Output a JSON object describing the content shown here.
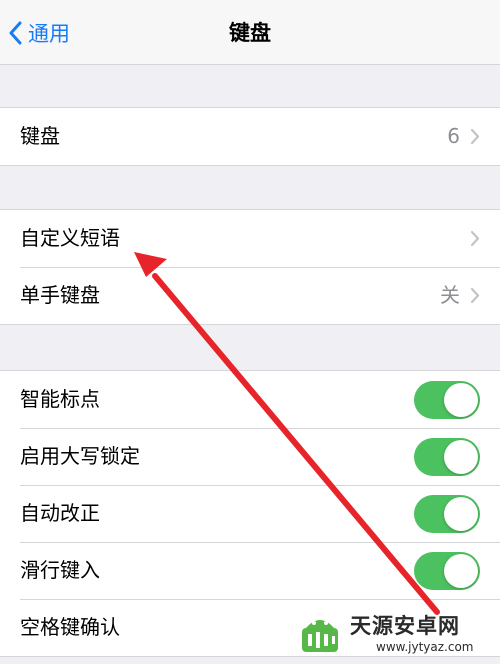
{
  "nav": {
    "back_label": "通用",
    "title": "键盘"
  },
  "section1": {
    "keyboards": {
      "label": "键盘",
      "value": "6"
    }
  },
  "section2": {
    "text_replacement": {
      "label": "自定义短语"
    },
    "one_handed": {
      "label": "单手键盘",
      "value": "关"
    }
  },
  "section3": {
    "items": [
      {
        "label": "智能标点",
        "on": true
      },
      {
        "label": "启用大写锁定",
        "on": true
      },
      {
        "label": "自动改正",
        "on": true
      },
      {
        "label": "滑行键入",
        "on": true
      },
      {
        "label": "空格键确认",
        "on": false
      }
    ]
  },
  "watermark": {
    "title": "天源安卓网",
    "url": "www.jytyaz.com"
  },
  "colors": {
    "accent": "#1a7cf5",
    "toggle_on": "#4cc15f",
    "annotation_arrow": "#e8242b"
  }
}
